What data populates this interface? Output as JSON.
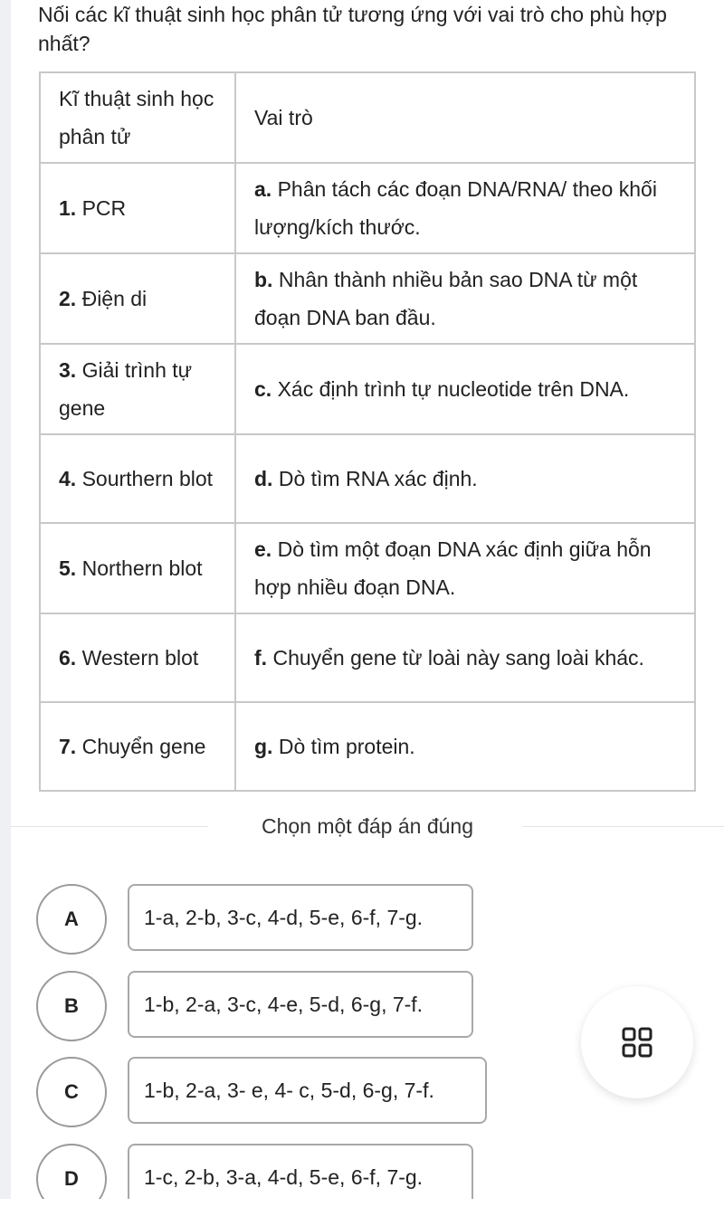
{
  "question": {
    "text": "Nối các kĩ thuật sinh học phân tử tương ứng với vai trò cho phù hợp nhất?"
  },
  "table": {
    "headers": [
      "Kĩ thuật sinh học phân tử",
      "Vai trò"
    ],
    "rows": [
      {
        "num": "1.",
        "technique": " PCR",
        "key": "a.",
        "role": " Phân tách các đoạn DNA/RNA/ theo khối lượng/kích thước."
      },
      {
        "num": "2.",
        "technique": " Điện di",
        "key": "b.",
        "role": " Nhân thành nhiều bản sao DNA từ một đoạn DNA ban đầu."
      },
      {
        "num": "3.",
        "technique": " Giải trình tự gene",
        "key": "c.",
        "role": " Xác định trình tự nucleotide trên DNA."
      },
      {
        "num": "4.",
        "technique": " Sourthern blot",
        "key": "d.",
        "role": " Dò tìm RNA xác định."
      },
      {
        "num": "5.",
        "technique": " Northern blot",
        "key": "e.",
        "role": " Dò tìm một đoạn DNA xác định giữa hỗn hợp nhiều đoạn DNA."
      },
      {
        "num": "6.",
        "technique": " Western blot",
        "key": "f.",
        "role": " Chuyển gene từ loài này sang loài khác."
      },
      {
        "num": "7.",
        "technique": " Chuyển gene",
        "key": "g.",
        "role": " Dò tìm protein."
      }
    ]
  },
  "divider": {
    "label": "Chọn một đáp án đúng"
  },
  "options": [
    {
      "letter": "A",
      "text": "1-a, 2-b, 3-c, 4-d, 5-e, 6-f, 7-g."
    },
    {
      "letter": "B",
      "text": "1-b, 2-a, 3-c, 4-e, 5-d, 6-g, 7-f."
    },
    {
      "letter": "C",
      "text": "1-b, 2-a, 3- e, 4- c, 5-d, 6-g, 7-f."
    },
    {
      "letter": "D",
      "text": "1-c, 2-b, 3-a, 4-d, 5-e, 6-f, 7-g."
    }
  ],
  "fab": {
    "icon": "grid-icon"
  }
}
